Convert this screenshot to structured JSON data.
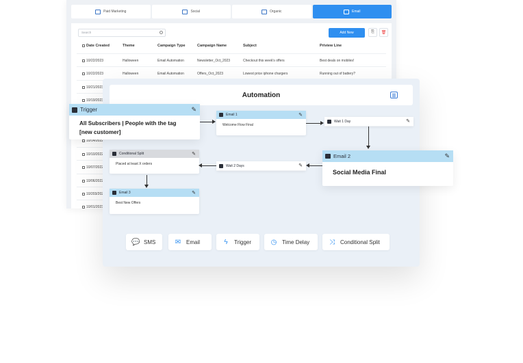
{
  "tabs": [
    {
      "label": "Paid Marketing",
      "icon": "megaphone-icon"
    },
    {
      "label": "Social",
      "icon": "social-icon"
    },
    {
      "label": "Organic",
      "icon": "organic-icon"
    },
    {
      "label": "Email",
      "icon": "mail-icon",
      "active": true
    }
  ],
  "table": {
    "search_placeholder": "Search",
    "add_button": "Add New",
    "columns": [
      "Date Created",
      "Theme",
      "Campaign Type",
      "Campaign Name",
      "Subject",
      "Priview Line"
    ],
    "rows": [
      {
        "date": "10/22/2023",
        "theme": "Halloween",
        "type": "Email Automation",
        "name": "Newsletter_Oct_2023",
        "subject": "Checkout this week's offers",
        "preview": "Best deals on mobiles!"
      },
      {
        "date": "10/22/2023",
        "theme": "Halloween",
        "type": "Email Automation",
        "name": "Offers_Oct_2023",
        "subject": "Lowest price iphone chargers",
        "preview": "Running out of battery?"
      },
      {
        "date": "10/21/2023"
      },
      {
        "date": "10/19/2023"
      },
      {
        "date": "10/14/2022"
      },
      {
        "date": "10/13/2022"
      },
      {
        "date": "10/10/2022"
      },
      {
        "date": "10/07/2022"
      },
      {
        "date": "10/06/2022"
      },
      {
        "date": "10/203/2023"
      },
      {
        "date": "10/01/2023"
      }
    ]
  },
  "automation": {
    "title": "Automation",
    "trigger": {
      "label": "Trigger",
      "body": "All Subscribers | People with the tag [new customer]"
    },
    "email1": {
      "label": "Email 1",
      "body": "Welcome Flow Final"
    },
    "wait1": {
      "label": "Wait 1 Day"
    },
    "email2": {
      "label": "Email 2",
      "body": "Social Media Final"
    },
    "wait2": {
      "label": "Wait 2 Days"
    },
    "split": {
      "label": "Conditional Split",
      "body": "Placed at least X orders"
    },
    "email3": {
      "label": "Email 3",
      "body": "Best New Offers"
    }
  },
  "toolbar": [
    {
      "label": "SMS",
      "icon": "sms-icon"
    },
    {
      "label": "Email",
      "icon": "email-icon"
    },
    {
      "label": "Trigger",
      "icon": "lightning-icon"
    },
    {
      "label": "Time Delay",
      "icon": "clock-icon"
    },
    {
      "label": "Conditional Split",
      "icon": "split-icon"
    }
  ],
  "colors": {
    "accent": "#2f8ff0",
    "node_header": "#b6def4",
    "panel_bg": "#eaf0f7"
  }
}
